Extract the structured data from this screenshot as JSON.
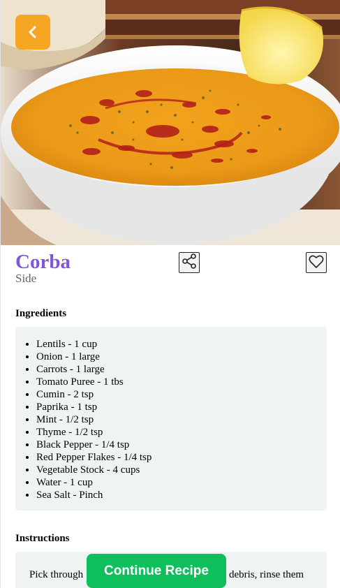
{
  "recipe": {
    "title": "Corba",
    "category": "Side"
  },
  "header": {
    "back_icon": "chevron-left-icon",
    "back_color": "#f6a623"
  },
  "actions": {
    "share_icon": "share-icon",
    "favorite_icon": "heart-icon"
  },
  "ingredients": {
    "heading": "Ingredients",
    "items": [
      "Lentils - 1 cup",
      "Onion - 1 large",
      "Carrots - 1 large",
      "Tomato Puree - 1 tbs",
      "Cumin - 2 tsp",
      "Paprika - 1 tsp",
      "Mint - 1/2 tsp",
      "Thyme - 1/2 tsp",
      "Black Pepper - 1/4 tsp",
      "Red Pepper Flakes - 1/4 tsp",
      "Vegetable Stock - 4 cups",
      "Water - 1 cup",
      "Sea Salt - Pinch"
    ]
  },
  "instructions": {
    "heading": "Instructions",
    "text_start": "Pick through",
    "text_end": "debris, rinse them"
  },
  "continue_button": {
    "label": "Continue Recipe",
    "color": "#0fbf5b"
  },
  "theme": {
    "title_color": "#7f56d9",
    "panel_bg": "#eff3f3"
  }
}
